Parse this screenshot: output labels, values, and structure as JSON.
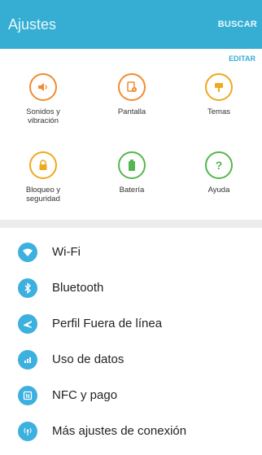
{
  "header": {
    "title": "Ajustes",
    "search_label": "BUSCAR"
  },
  "quick_settings": {
    "edit_label": "EDITAR",
    "items": [
      {
        "label": "Sonidos y\nvibración",
        "icon": "speaker-icon",
        "color": "#f28b30"
      },
      {
        "label": "Pantalla",
        "icon": "display-icon",
        "color": "#f28b30"
      },
      {
        "label": "Temas",
        "icon": "brush-icon",
        "color": "#f0a81e"
      },
      {
        "label": "Bloqueo y\nseguridad",
        "icon": "lock-icon",
        "color": "#f0a81e"
      },
      {
        "label": "Batería",
        "icon": "battery-icon",
        "color": "#53b74e"
      },
      {
        "label": "Ayuda",
        "icon": "help-icon",
        "color": "#53b74e"
      }
    ]
  },
  "connections": {
    "accent_color": "#3cb0de",
    "items": [
      {
        "label": "Wi-Fi",
        "icon": "wifi-icon"
      },
      {
        "label": "Bluetooth",
        "icon": "bluetooth-icon"
      },
      {
        "label": "Perfil Fuera de línea",
        "icon": "airplane-icon"
      },
      {
        "label": "Uso de datos",
        "icon": "data-usage-icon"
      },
      {
        "label": "NFC y pago",
        "icon": "nfc-icon"
      },
      {
        "label": "Más ajustes de conexión",
        "icon": "more-connection-icon"
      }
    ]
  }
}
